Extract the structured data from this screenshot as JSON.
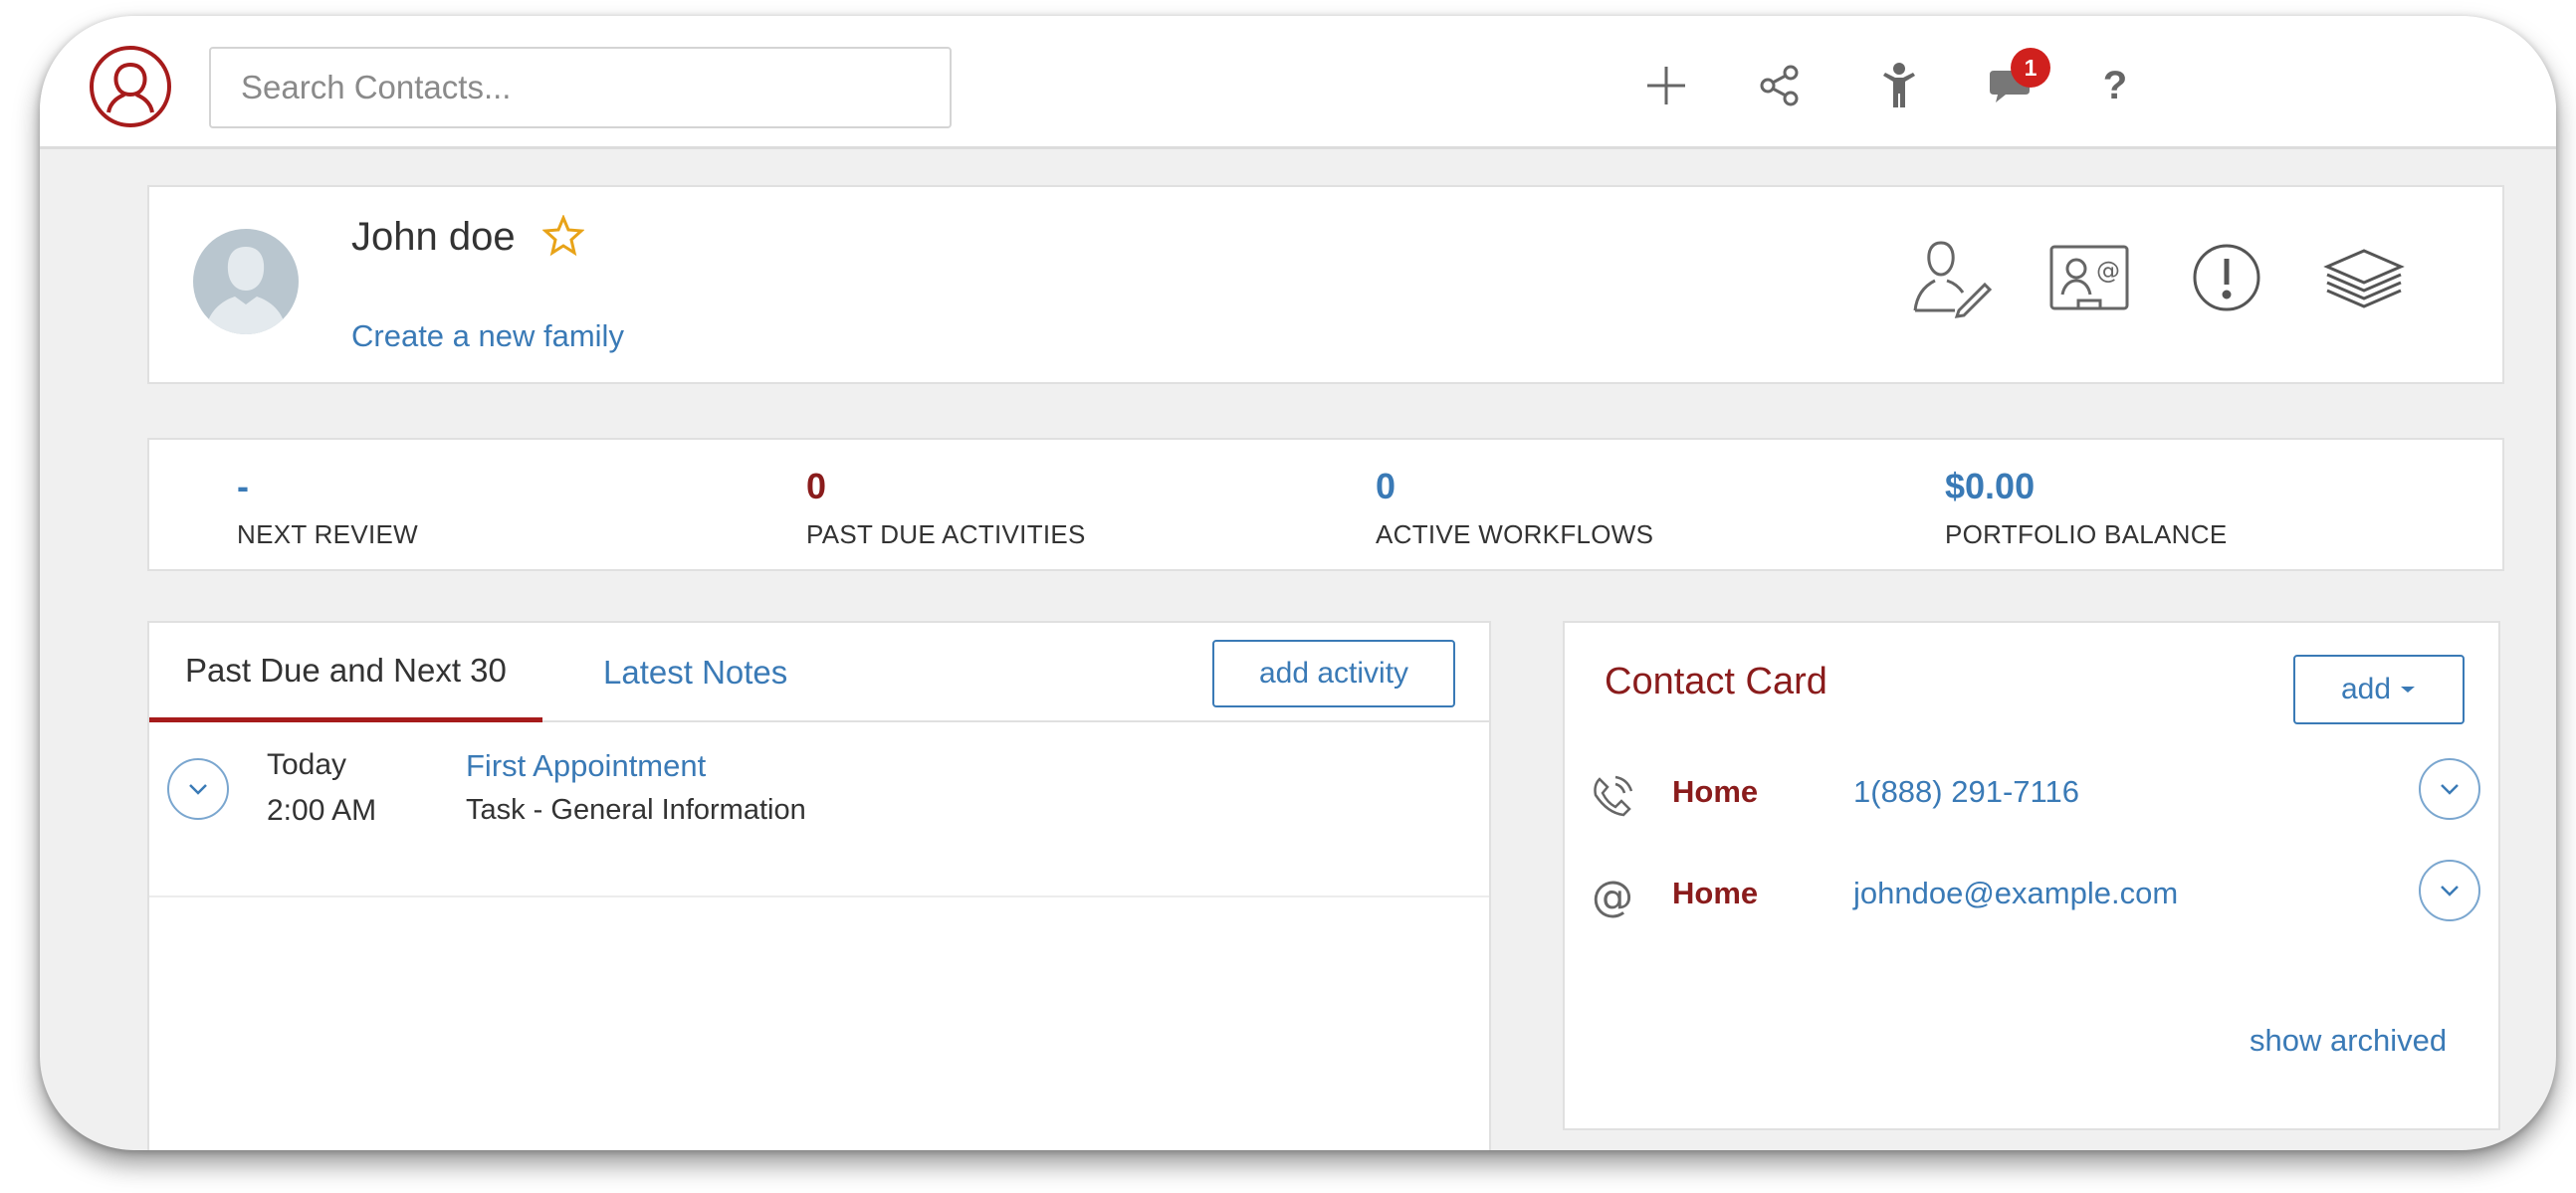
{
  "header": {
    "search_placeholder": "Search Contacts...",
    "icons": [
      "add-icon",
      "share-icon",
      "person-icon",
      "notifications-icon",
      "help-icon"
    ],
    "notification_count": "1",
    "help_label": "?"
  },
  "profile": {
    "name": "John doe",
    "family_link": "Create a new family",
    "icons": [
      "edit-contact-icon",
      "contact-card-icon",
      "alert-icon",
      "layers-icon"
    ]
  },
  "stats": [
    {
      "value": "-",
      "label": "NEXT REVIEW",
      "color": "#3a7ab6"
    },
    {
      "value": "0",
      "label": "PAST DUE ACTIVITIES",
      "color": "#8a1c1c"
    },
    {
      "value": "0",
      "label": "ACTIVE WORKFLOWS",
      "color": "#3a7ab6"
    },
    {
      "value": "$0.00",
      "label": "PORTFOLIO BALANCE",
      "color": "#3a7ab6"
    }
  ],
  "activities": {
    "tabs": [
      {
        "label": "Past Due and Next 30",
        "active": true
      },
      {
        "label": "Latest Notes",
        "active": false
      }
    ],
    "add_button": "add activity",
    "items": [
      {
        "date": "Today",
        "time": "2:00 AM",
        "title": "First Appointment",
        "description": "Task - General Information"
      }
    ]
  },
  "contact_card": {
    "title": "Contact Card",
    "add_button": "add",
    "entries": [
      {
        "icon": "phone-icon",
        "type": "Home",
        "value": "1(888) 291-7116"
      },
      {
        "icon": "email-at-icon",
        "type": "Home",
        "value": "johndoe@example.com"
      }
    ],
    "show_archived": "show archived"
  },
  "colors": {
    "brand_red": "#a61b1b",
    "dark_red": "#8a1c1c",
    "link_blue": "#3a7ab6",
    "badge_red": "#d0201d",
    "background": "#f0f0f0"
  }
}
